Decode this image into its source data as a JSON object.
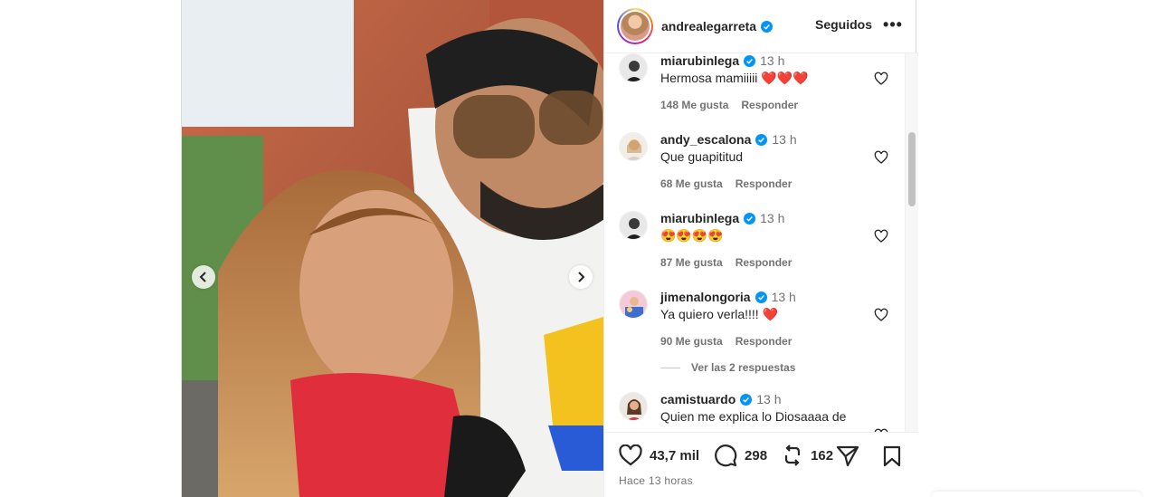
{
  "post": {
    "author": "andrealegarreta",
    "following_label": "Seguidos",
    "more_label": "•••",
    "likes": "43,7 mil",
    "comments_count": "298",
    "reposts": "162",
    "timestamp": "Hace 13 horas"
  },
  "comments": [
    {
      "user": "miarubinlega",
      "time": "13 h",
      "text": "Hermosa mamiiiii ❤️❤️❤️",
      "likes": "148 Me gusta",
      "reply": "Responder"
    },
    {
      "user": "andy_escalona",
      "time": "13 h",
      "text": "Que guapititud",
      "likes": "68 Me gusta",
      "reply": "Responder"
    },
    {
      "user": "miarubinlega",
      "time": "13 h",
      "text": "😍😍😍😍",
      "likes": "87 Me gusta",
      "reply": "Responder"
    },
    {
      "user": "jimenalongoria",
      "time": "13 h",
      "text": "Ya quiero verla!!!! ❤️",
      "likes": "90 Me gusta",
      "reply": "Responder"
    },
    {
      "user": "camistuardo",
      "time": "13 h",
      "text": "Quien me explica lo Diosaaaa de"
    }
  ],
  "view_replies": "Ver las 2 respuestas",
  "icons": {
    "verified": "verified-badge-icon",
    "like": "heart-icon",
    "comment": "comment-icon",
    "repost": "repost-icon",
    "share": "share-icon",
    "save": "bookmark-icon",
    "prev": "chevron-left-icon",
    "next": "chevron-right-icon"
  },
  "colors": {
    "verified_blue": "#0095f6",
    "text_primary": "#262626",
    "text_secondary": "#737373",
    "divider": "#efefef"
  }
}
